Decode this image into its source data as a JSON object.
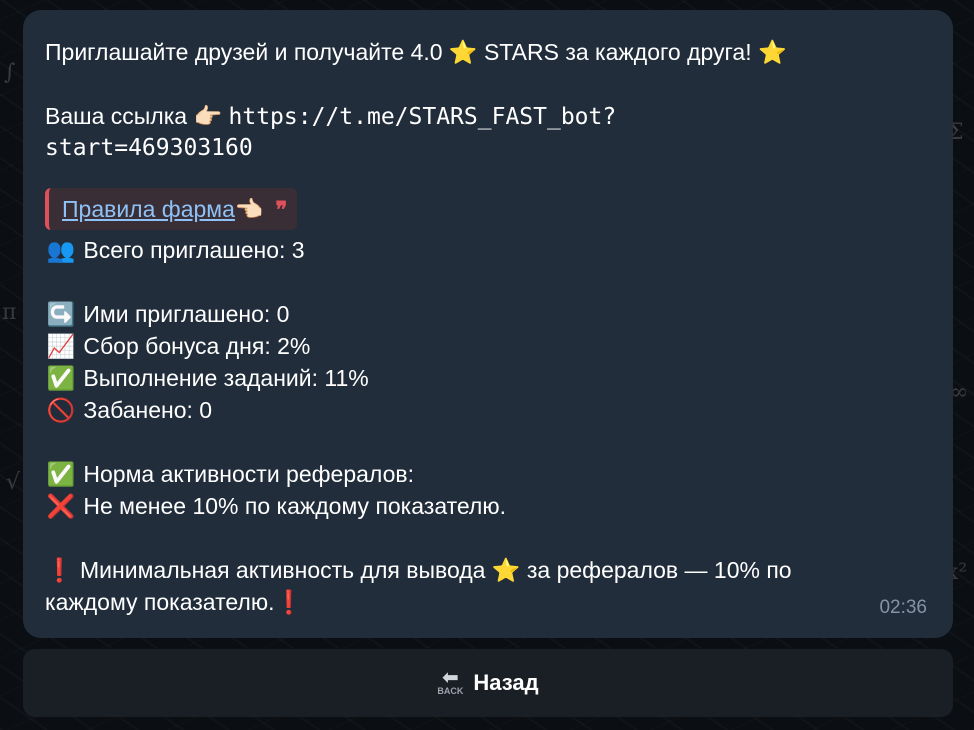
{
  "message": {
    "line1_text": "Приглашайте друзей и получайте 4.0 ⭐ STARS за каждого друга! ⭐",
    "link_label": "Ваша ссылка 👉🏻 ",
    "link_url_part1": "https://t.me/STARS_FAST_bot?",
    "link_url_part2": "start=469303160",
    "quote_link": "Правила фарма",
    "quote_emoji": "👈🏻",
    "quote_mark": "❞",
    "stats": [
      {
        "icon": "👥",
        "icon_name": "people-icon",
        "text": "Всего приглашено: 3"
      },
      {
        "icon": "↪️",
        "icon_name": "return-arrow-icon",
        "text": "Ими приглашено: 0"
      },
      {
        "icon": "📈",
        "icon_name": "chart-up-icon",
        "text": "Сбор бонуса дня: 2%"
      },
      {
        "icon": "✅",
        "icon_name": "check-mark-icon",
        "text": "Выполнение заданий: 11%"
      },
      {
        "icon": "🚫",
        "icon_name": "no-entry-icon",
        "text": "Забанено: 0"
      }
    ],
    "norm": [
      {
        "icon": "✅",
        "icon_name": "check-mark-icon",
        "text": "Норма активности рефералов:"
      },
      {
        "icon": "❌",
        "icon_name": "cross-mark-icon",
        "text": "Не менее 10% по каждому показателю."
      }
    ],
    "warning_line1": "❗ Минимальная активность для вывода ⭐ за рефералов — 10% по",
    "warning_line2": "каждому показателю.❗",
    "time": "02:36"
  },
  "keyboard": {
    "back_icon_text": "BACK",
    "back_icon_arrow": "⬅",
    "back_label": "Назад"
  },
  "colors": {
    "bubble": "#212d3b",
    "link": "#8ec2f7",
    "quote_accent": "#e0505a",
    "time": "#8593a3"
  }
}
